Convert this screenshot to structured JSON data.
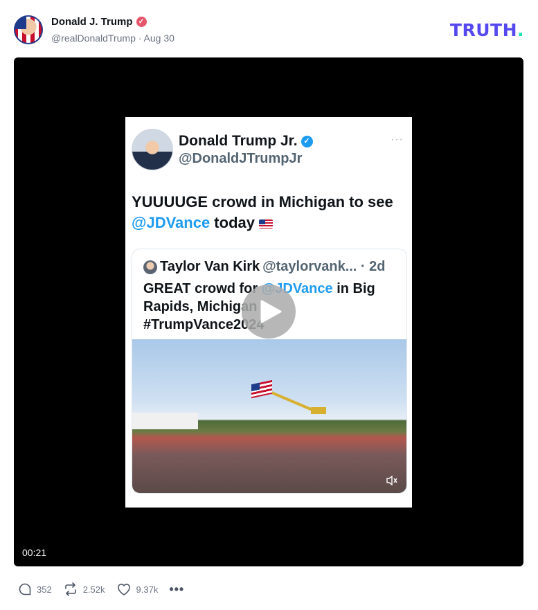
{
  "post": {
    "display_name": "Donald J. Trump",
    "handle": "@realDonaldTrump",
    "separator": " · ",
    "date": "Aug 30",
    "logo_main": "TRUTH",
    "logo_dot": ".",
    "brand_color": "#5448ee",
    "verified_color": "#e5556c"
  },
  "video": {
    "duration": "00:21",
    "embedded_post": {
      "author": "Donald Trump Jr.",
      "handle": "@DonaldJTrumpJr",
      "more": "···",
      "text_before": "YUUUUGE crowd in Michigan to see ",
      "mention": "@JDVance",
      "text_after": " today",
      "quote": {
        "author": "Taylor Van Kirk",
        "handle": "@taylorvank... · 2d",
        "line1_before": "GREAT crowd for ",
        "line1_mention": "@JDVance",
        "line1_after": " in Big",
        "line2": "Rapids, Michigan",
        "line3": "#TrumpVance2024"
      }
    }
  },
  "actions": {
    "replies": "352",
    "retruths": "2.52k",
    "likes": "9.37k",
    "more": "•••"
  }
}
